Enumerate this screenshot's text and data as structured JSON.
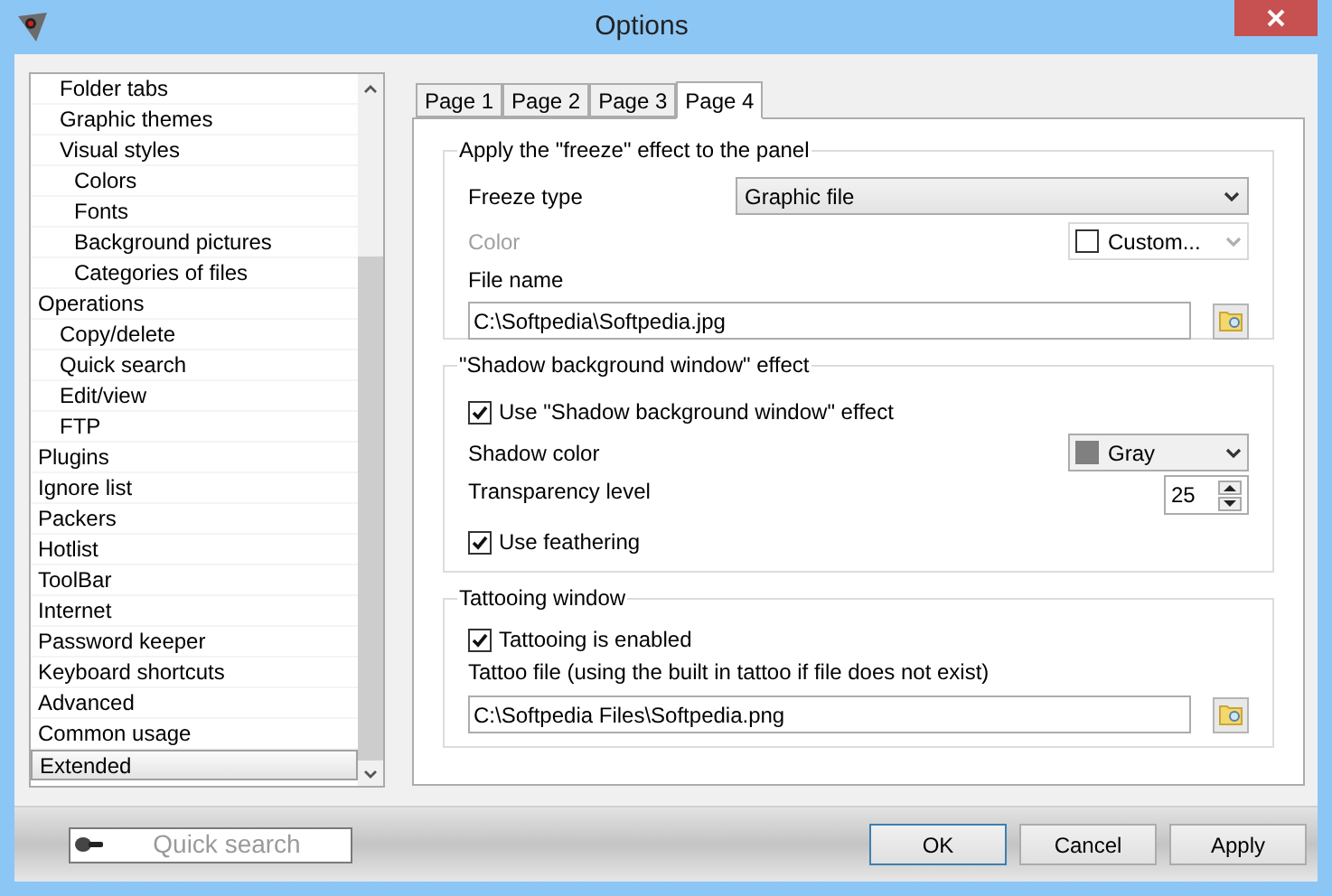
{
  "window": {
    "title": "Options"
  },
  "tree": {
    "items": [
      {
        "children": [
          {
            "label": "Folder tabs",
            "selected": false
          },
          {
            "label": "Graphic themes",
            "selected": false
          },
          {
            "label": "Visual styles",
            "selected": false,
            "children": [
              {
                "label": "Colors",
                "selected": false
              },
              {
                "label": "Fonts",
                "selected": false
              },
              {
                "label": "Background pictures",
                "selected": false
              },
              {
                "label": "Categories of files",
                "selected": false
              }
            ]
          }
        ]
      },
      {
        "label": "Operations",
        "selected": false,
        "children": [
          {
            "label": "Copy/delete",
            "selected": false
          },
          {
            "label": "Quick search",
            "selected": false
          },
          {
            "label": "Edit/view",
            "selected": false
          },
          {
            "label": "FTP",
            "selected": false
          }
        ]
      },
      {
        "label": "Plugins",
        "selected": false
      },
      {
        "label": "Ignore list",
        "selected": false
      },
      {
        "label": "Packers",
        "selected": false
      },
      {
        "label": "Hotlist",
        "selected": false
      },
      {
        "label": "ToolBar",
        "selected": false
      },
      {
        "label": "Internet",
        "selected": false
      },
      {
        "label": "Password keeper",
        "selected": false
      },
      {
        "label": "Keyboard shortcuts",
        "selected": false
      },
      {
        "label": "Advanced",
        "selected": false
      },
      {
        "label": "Common usage",
        "selected": false
      },
      {
        "label": "Extended",
        "selected": true
      }
    ]
  },
  "tabs": [
    {
      "label": "Page 1",
      "selected": false
    },
    {
      "label": "Page 2",
      "selected": false
    },
    {
      "label": "Page 3",
      "selected": false
    },
    {
      "label": "Page 4",
      "selected": true
    }
  ],
  "freeze_group": {
    "title": "Apply the \"freeze\" effect to the panel",
    "freeze_type": {
      "label": "Freeze type",
      "value": "Graphic file"
    },
    "color": {
      "label": "Color",
      "disabled": true,
      "value": "Custom...",
      "color": "#ffffff"
    },
    "file_name": {
      "label": "File name",
      "value": "C:\\Softpedia\\Softpedia.jpg"
    }
  },
  "shadow_group": {
    "title": "\"Shadow background window\" effect",
    "use_shadow": {
      "label": "Use \"Shadow background window\" effect",
      "checked": true
    },
    "shadow_color": {
      "label": "Shadow color",
      "value": "Gray",
      "color": "#808080"
    },
    "transparency": {
      "label": "Transparency level",
      "value": "25"
    },
    "feathering": {
      "label": "Use feathering",
      "checked": true
    }
  },
  "tattoo_group": {
    "title": "Tattooing window",
    "enabled": {
      "label": "Tattooing is enabled",
      "checked": true
    },
    "file": {
      "label": "Tattoo file (using the built in tattoo if file does not exist)",
      "value": "C:\\Softpedia Files\\Softpedia.png"
    }
  },
  "quick_search": {
    "placeholder": "Quick search"
  },
  "buttons": [
    {
      "label": "OK",
      "default": true
    },
    {
      "label": "Cancel",
      "default": false
    },
    {
      "label": "Apply",
      "default": false
    }
  ]
}
